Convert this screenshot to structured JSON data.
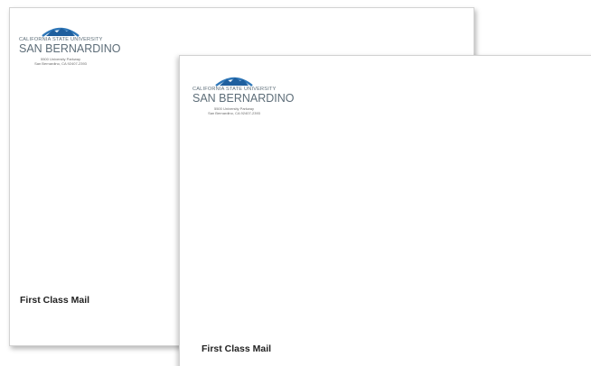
{
  "envelopes": {
    "back": {
      "university_line1": "CALIFORNIA STATE UNIVERSITY",
      "university_line2": "SAN BERNARDINO",
      "address_line1": "5500 University Parkway",
      "address_line2": "San Bernardino, CA 92407-2393",
      "postage": "First Class Mail"
    },
    "front": {
      "university_line1": "CALIFORNIA STATE UNIVERSITY",
      "university_line2": "SAN BERNARDINO",
      "address_line1": "5500 University Parkway",
      "address_line2": "San Bernardino, CA 92407-2393",
      "postage": "First Class Mail"
    }
  },
  "colors": {
    "logo_arc_blue": "#2f77b8",
    "logo_mountain_blue": "#1f5f9e",
    "logo_text": "#5d6d78",
    "postage_text": "#222222"
  },
  "icons": {
    "logo": "mountain-arc-logo-icon"
  }
}
